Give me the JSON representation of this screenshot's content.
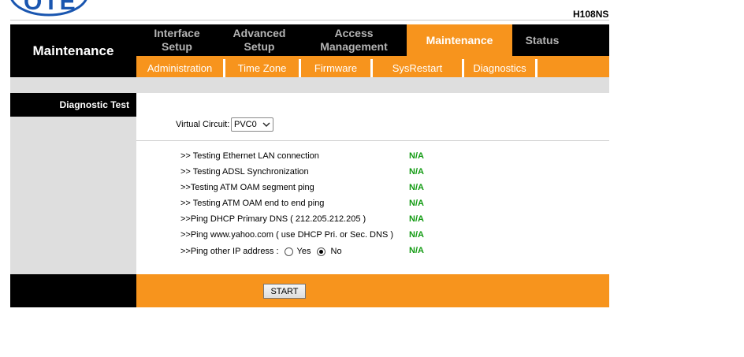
{
  "header": {
    "logo_text": "OTE",
    "model": "H108NS",
    "section_title": "Maintenance"
  },
  "top_nav": [
    {
      "label": "Interface\nSetup",
      "active": false
    },
    {
      "label": "Advanced\nSetup",
      "active": false
    },
    {
      "label": "Access\nManagement",
      "active": false
    },
    {
      "label": "Maintenance",
      "active": true
    },
    {
      "label": "Status",
      "active": false
    }
  ],
  "sub_nav": [
    {
      "label": "Administration"
    },
    {
      "label": "Time Zone"
    },
    {
      "label": "Firmware"
    },
    {
      "label": "SysRestart"
    },
    {
      "label": "Diagnostics"
    }
  ],
  "side": {
    "heading": "Diagnostic Test"
  },
  "virtual_circuit": {
    "label": "Virtual Circuit:",
    "selected": "PVC0"
  },
  "tests": [
    {
      "label": ">> Testing Ethernet LAN connection",
      "status": "N/A"
    },
    {
      "label": ">> Testing ADSL Synchronization",
      "status": "N/A"
    },
    {
      "label": ">>Testing ATM OAM segment ping",
      "status": "N/A"
    },
    {
      "label": ">> Testing ATM OAM end to end ping",
      "status": "N/A"
    },
    {
      "label": ">>Ping DHCP Primary DNS ( 212.205.212.205 )",
      "status": "N/A"
    },
    {
      "label": ">>Ping www.yahoo.com ( use DHCP Pri. or Sec. DNS )",
      "status": "N/A"
    },
    {
      "label": ">>Ping other IP address :",
      "status": "N/A"
    }
  ],
  "ping_other": {
    "yes_label": "Yes",
    "no_label": "No",
    "selected": "No"
  },
  "footer": {
    "start_label": "START"
  },
  "colors": {
    "accent_orange": "#f7941d",
    "status_green": "#119a11",
    "header_black": "#000000"
  }
}
